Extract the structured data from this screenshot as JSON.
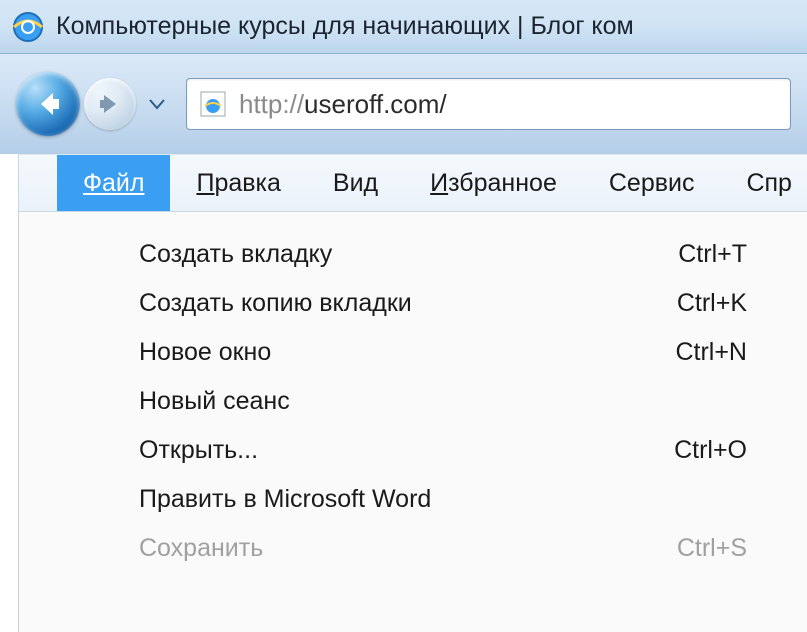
{
  "window": {
    "title": "Компьютерные курсы для начинающих | Блог ком"
  },
  "address": {
    "protocol": "http://",
    "host": "useroff.com/"
  },
  "menubar": {
    "file": "Файл",
    "edit": "Правка",
    "view": "Вид",
    "favorites": "Избранное",
    "tools": "Сервис",
    "help": "Спр"
  },
  "file_menu": [
    {
      "label": "Создать вкладку",
      "shortcut": "Ctrl+T",
      "disabled": false
    },
    {
      "label": "Создать копию вкладки",
      "shortcut": "Ctrl+K",
      "disabled": false
    },
    {
      "label": "Новое окно",
      "shortcut": "Ctrl+N",
      "disabled": false
    },
    {
      "label": "Новый сеанс",
      "shortcut": "",
      "disabled": false
    },
    {
      "label": "Открыть...",
      "shortcut": "Ctrl+O",
      "disabled": false
    },
    {
      "label": "Править в Microsoft Word",
      "shortcut": "",
      "disabled": false
    },
    {
      "label": "Сохранить",
      "shortcut": "Ctrl+S",
      "disabled": true
    }
  ]
}
